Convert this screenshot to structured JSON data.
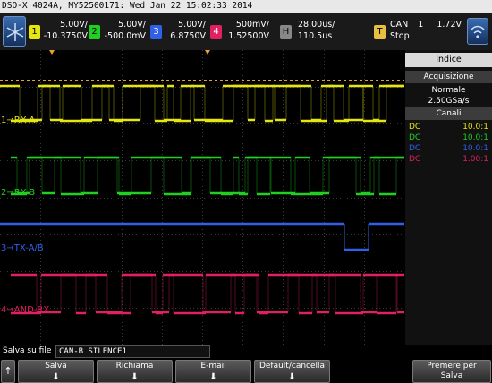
{
  "title_bar": "DSO-X 4024A, MY52500171: Wed Jan 22 15:02:33 2014",
  "channels": [
    {
      "num": "1",
      "scale": "5.00V/",
      "offset": "-10.3750V",
      "color": "#e5e510"
    },
    {
      "num": "2",
      "scale": "5.00V/",
      "offset": "-500.0mV",
      "color": "#20d020"
    },
    {
      "num": "3",
      "scale": "5.00V/",
      "offset": "6.8750V",
      "color": "#3060e8"
    },
    {
      "num": "4",
      "scale": "500mV/",
      "offset": "1.52500V",
      "color": "#e02060"
    }
  ],
  "horizontal": {
    "key": "H",
    "scale": "28.00us/",
    "position": "110.5us"
  },
  "trigger": {
    "key": "T",
    "mode": "CAN",
    "source": "1",
    "level": "1.72V",
    "state": "Stop"
  },
  "waveforms": [
    {
      "label": "1→RX-A",
      "color": "#e5e510"
    },
    {
      "label": "2→RX-B",
      "color": "#20d020"
    },
    {
      "label": "3→TX-A/B",
      "color": "#3060e8"
    },
    {
      "label": "4→AND-RX",
      "color": "#e02060"
    }
  ],
  "panel": {
    "tab": "Indice",
    "acq_header": "Acquisizione",
    "acq_mode": "Normale",
    "sample_rate": "2.50GSa/s",
    "channels_header": "Canali",
    "coupling": [
      {
        "coupling": "DC",
        "probe": "10.0:1",
        "color": "#e5e510"
      },
      {
        "coupling": "DC",
        "probe": "10.0:1",
        "color": "#20d020"
      },
      {
        "coupling": "DC",
        "probe": "10.0:1",
        "color": "#3060e8"
      },
      {
        "coupling": "DC",
        "probe": "1.00:1",
        "color": "#e02060"
      }
    ]
  },
  "save": {
    "label": "Salva su file =",
    "filename": "CAN-B SILENCE1"
  },
  "softkeys": {
    "up_arrow": "↑",
    "salva": "Salva",
    "richiama": "Richiama",
    "email": "E-mail",
    "default": "Default/cancella",
    "premere_line1": "Premere per",
    "premere_line2": "Salva",
    "down_arrow": "⬇"
  }
}
